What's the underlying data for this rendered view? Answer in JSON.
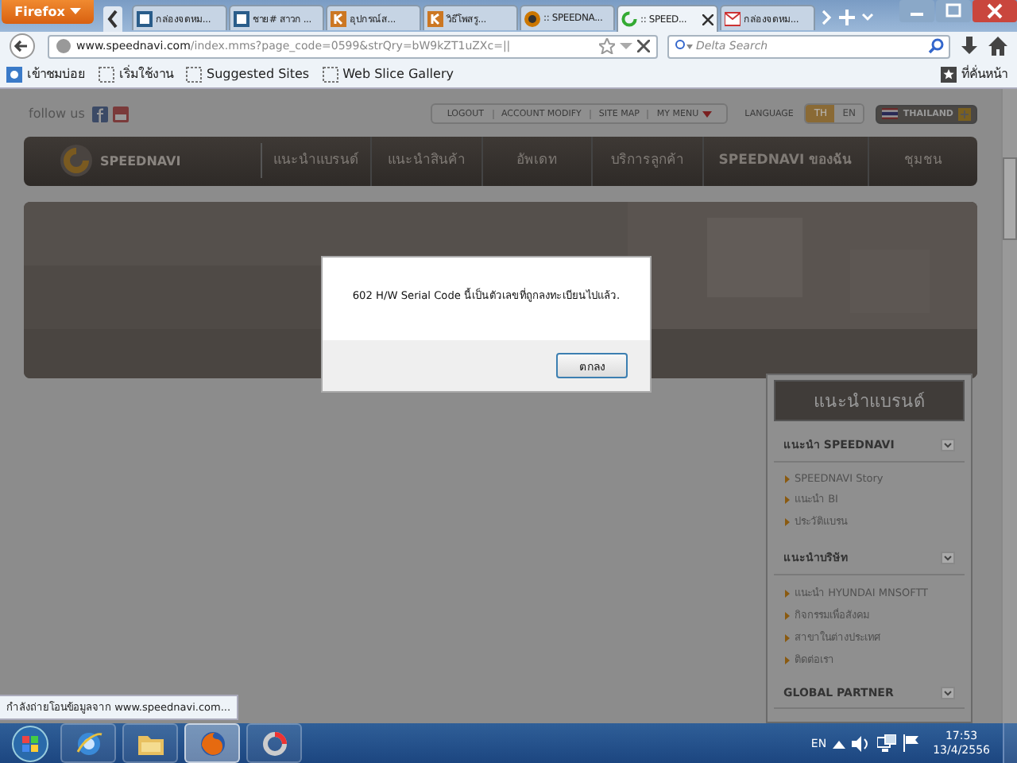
{
  "browser": {
    "menu_button": "Firefox",
    "tabs": [
      {
        "label": "กล่องจดหม...",
        "kind": "doc",
        "selected": false
      },
      {
        "label": "ชาย# สาวก ...",
        "kind": "doc",
        "selected": false
      },
      {
        "label": "อุปกรณ์ส...",
        "kind": "k",
        "selected": false
      },
      {
        "label": "วิธีโพสรู...",
        "kind": "k",
        "selected": false
      },
      {
        "label": ":: SPEEDNA...",
        "kind": "site",
        "selected": false
      },
      {
        "label": ":: SPEED...",
        "kind": "loading",
        "selected": true
      },
      {
        "label": "กล่องจดหม...",
        "kind": "mail",
        "selected": false
      }
    ],
    "url_host": "www.speednavi.com",
    "url_path": "/index.mms?page_code=0599&strQry=bW9kZT1uZXc=||",
    "search": {
      "placeholder": "Delta Search"
    },
    "bookmarks": [
      {
        "label": "เข้าชมบ่อย",
        "kind": "ie"
      },
      {
        "label": "เริ่มใช้งาน",
        "kind": "page"
      },
      {
        "label": "Suggested Sites",
        "kind": "page"
      },
      {
        "label": "Web Slice Gallery",
        "kind": "page"
      }
    ],
    "bookmarks_menu": "ที่คั่นหน้า"
  },
  "page": {
    "follow_label": "follow us",
    "top_links": [
      "LOGOUT",
      "ACCOUNT MODIFY",
      "SITE MAP",
      "MY MENU"
    ],
    "language_label": "LANGUAGE",
    "languages": [
      {
        "label": "TH",
        "selected": true
      },
      {
        "label": "EN",
        "selected": false
      }
    ],
    "region": "THAILAND",
    "logo": "SPEEDNAVI",
    "nav": [
      "แนะนำแบรนด์",
      "แนะนำสินค้า",
      "อัพเดท",
      "บริการลูกค้า",
      "SPEEDNAVI ของฉัน",
      "ชุมชน"
    ],
    "sidebar": {
      "title": "แนะนำแบรนด์",
      "sections": [
        {
          "title": "แนะนำ SPEEDNAVI",
          "items": [
            "SPEEDNAVI Story",
            "แนะนำ BI",
            "ประวัติแบรน"
          ]
        },
        {
          "title": "แนะนำบริษัท",
          "items": [
            "แนะนำ HYUNDAI MNSOFTT",
            "กิจกรรมเพื่อสังคม",
            "สาขาในต่างประเทศ",
            "ติดต่อเรา"
          ]
        },
        {
          "title": "GLOBAL PARTNER"
        }
      ]
    },
    "dialog": {
      "message": "602 H/W Serial Code นี้เป็นตัวเลขที่ถูกลงทะเบียนไปแล้ว.",
      "button": "ตกลง"
    }
  },
  "status_text": "กำลังถ่ายโอนข้อมูลจาก www.speednavi.com...",
  "taskbar": {
    "apps": [
      {
        "kind": "ie",
        "selected": false
      },
      {
        "kind": "folder",
        "selected": false
      },
      {
        "kind": "firefox",
        "selected": true
      },
      {
        "kind": "ring",
        "selected": false
      }
    ],
    "language": "EN",
    "time": "17:53",
    "date": "13/4/2556"
  }
}
